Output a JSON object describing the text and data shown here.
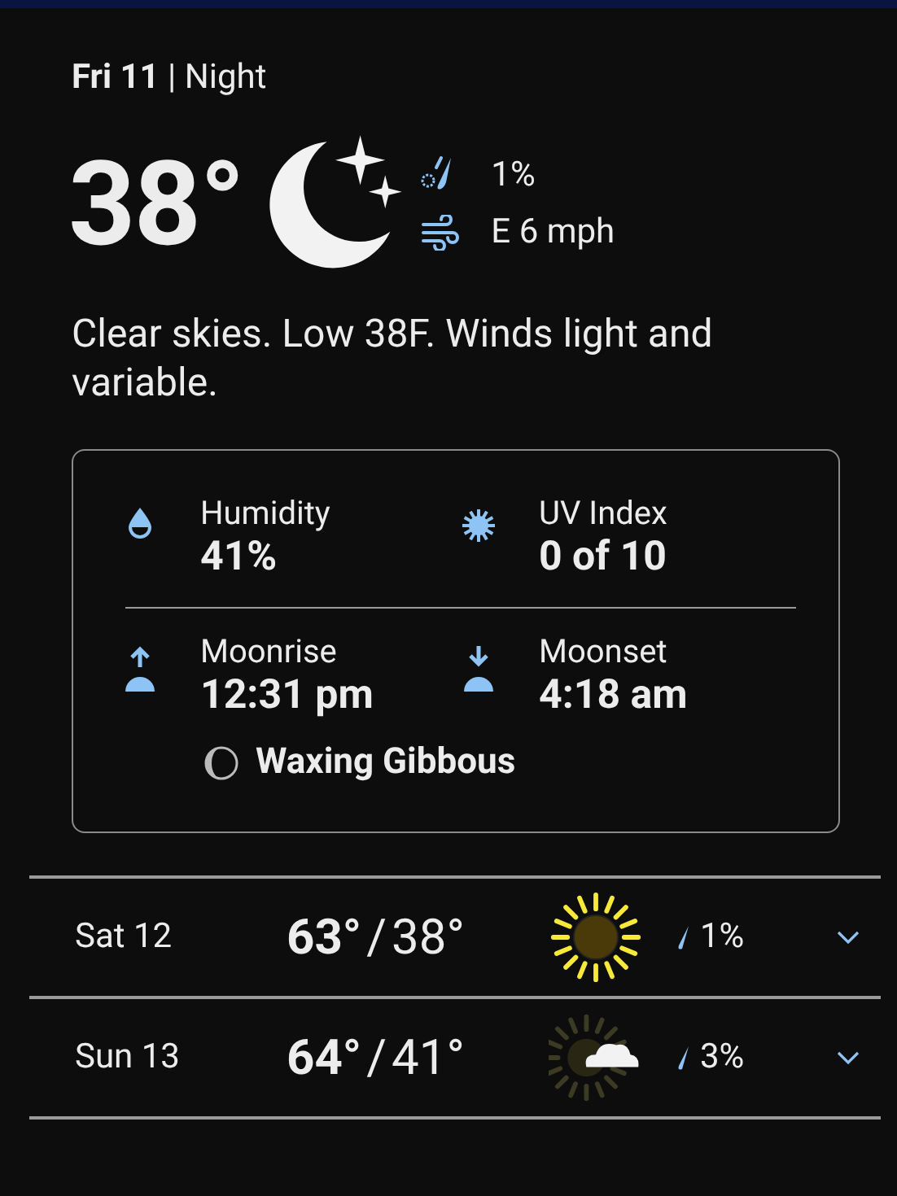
{
  "header": {
    "date": "**Fri 11** | Night"
  },
  "current": {
    "temperature": "38°",
    "kind": "clear-night",
    "precipitation": "1%",
    "wind": "E 6 mph"
  },
  "description": "Clear skies. Low 38F. Winds light and variable.",
  "details": {
    "rows": [
      [
        {
          "kind": "humidity",
          "label": "Humidity",
          "value": "41%"
        },
        {
          "kind": "uv",
          "label": "UV Index",
          "value": "0 of 10"
        }
      ],
      [
        {
          "kind": "moonrise",
          "label": "Moonrise",
          "value": "12:31 pm"
        },
        {
          "kind": "moonset",
          "label": "Moonset",
          "value": "4:18 am"
        }
      ]
    ],
    "moon_phase": "Waxing Gibbous"
  },
  "forecast": [
    {
      "day": "Sat 12",
      "high": "63°",
      "separator": "/",
      "low": "38°",
      "kind": "sunny",
      "precipitation": "1%",
      "expanded": false
    },
    {
      "day": "Sun 13",
      "high": "64°",
      "separator": "/",
      "low": "41°",
      "kind": "partly-cloudy",
      "precipitation": "3%",
      "expanded": false
    }
  ]
}
